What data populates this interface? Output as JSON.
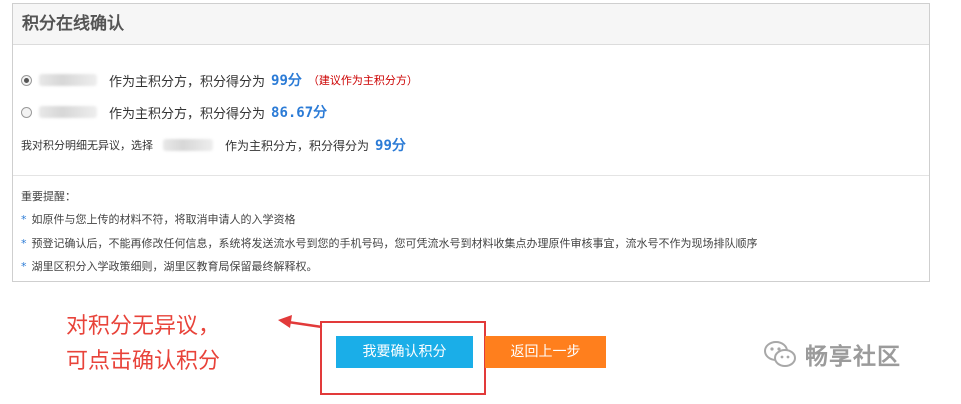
{
  "panel": {
    "title": "积分在线确认",
    "options": [
      {
        "role_text": "作为主积分方，积分得分为",
        "score": "99分",
        "suggestion": "（建议作为主积分方）",
        "selected": true
      },
      {
        "role_text": "作为主积分方，积分得分为",
        "score": "86.67分",
        "suggestion": "",
        "selected": false
      }
    ],
    "confirm_line": {
      "prefix": "我对积分明细无异议，选择",
      "middle": "作为主积分方，积分得分为",
      "score": "99分"
    },
    "notice": {
      "title": "重要提醒：",
      "items": [
        "如原件与您上传的材料不符，将取消申请人的入学资格",
        "预登记确认后，不能再修改任何信息，系统将发送流水号到您的手机号码，您可凭流水号到材料收集点办理原件审核事宜，流水号不作为现场排队顺序",
        "湖里区积分入学政策细则，湖里区教育局保留最终解释权。"
      ],
      "bullet": "*"
    }
  },
  "annotation": {
    "line1": "对积分无异议，",
    "line2": "可点击确认积分"
  },
  "buttons": {
    "confirm": "我要确认积分",
    "back": "返回上一步"
  },
  "watermark": {
    "text": "畅享社区",
    "icon": "wechat-icon"
  },
  "colors": {
    "score_blue": "#2b7bd6",
    "suggest_red": "#cc0000",
    "confirm_button": "#1aaee8",
    "back_button": "#ff7f1d",
    "annotation_red": "#e8433a"
  }
}
